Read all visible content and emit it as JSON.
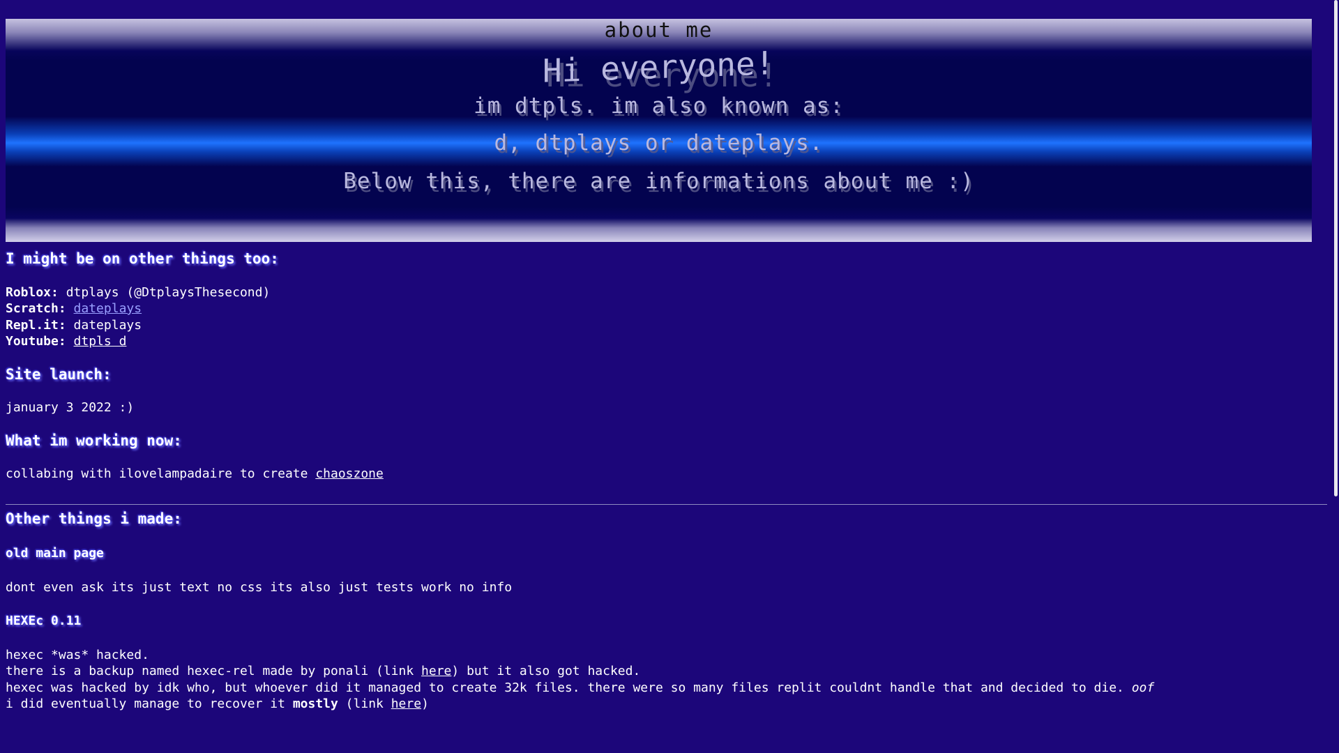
{
  "banner": {
    "title": "about me",
    "greeting": "Hi everyone!",
    "line2": "im dtpls. im also known as:",
    "line3": "d, dtplays or dateplays.",
    "line4": "Below this, there are informations about me :)"
  },
  "socials": {
    "heading": "I might be on other things too:",
    "roblox_label": "Roblox:",
    "roblox_value": "dtplays (@DtplaysThesecond)",
    "scratch_label": "Scratch:",
    "scratch_link": "dateplays",
    "replit_label": "Repl.it:",
    "replit_value": "dateplays",
    "youtube_label": "Youtube:",
    "youtube_link": "dtpls d"
  },
  "launch": {
    "heading": "Site launch:",
    "date": "january 3 2022 :)"
  },
  "working": {
    "heading": "What im working now:",
    "text": "collabing with ilovelampadaire to create ",
    "link": "chaoszone"
  },
  "other": {
    "heading": "Other things i made:",
    "item1_title": "old main page",
    "item1_desc": "dont even ask its just text no css its also just tests work no info",
    "item2_title": "HEXEc 0.11",
    "hexec_line1": "hexec *was* hacked.",
    "hexec_line2_a": "there is a backup named hexec-rel made by ponali (link ",
    "hexec_line2_link": "here",
    "hexec_line2_b": ") but it also got hacked.",
    "hexec_line3_a": "hexec was hacked by idk who, but whoever did it managed to create 32k files. there were so many files replit couldnt handle that and decided to die. ",
    "hexec_line3_em": "oof",
    "hexec_line4_a": "i did eventually manage to recover it ",
    "hexec_line4_b": "mostly",
    "hexec_line4_c": " (link ",
    "hexec_line4_link": "here",
    "hexec_line4_d": ")"
  }
}
